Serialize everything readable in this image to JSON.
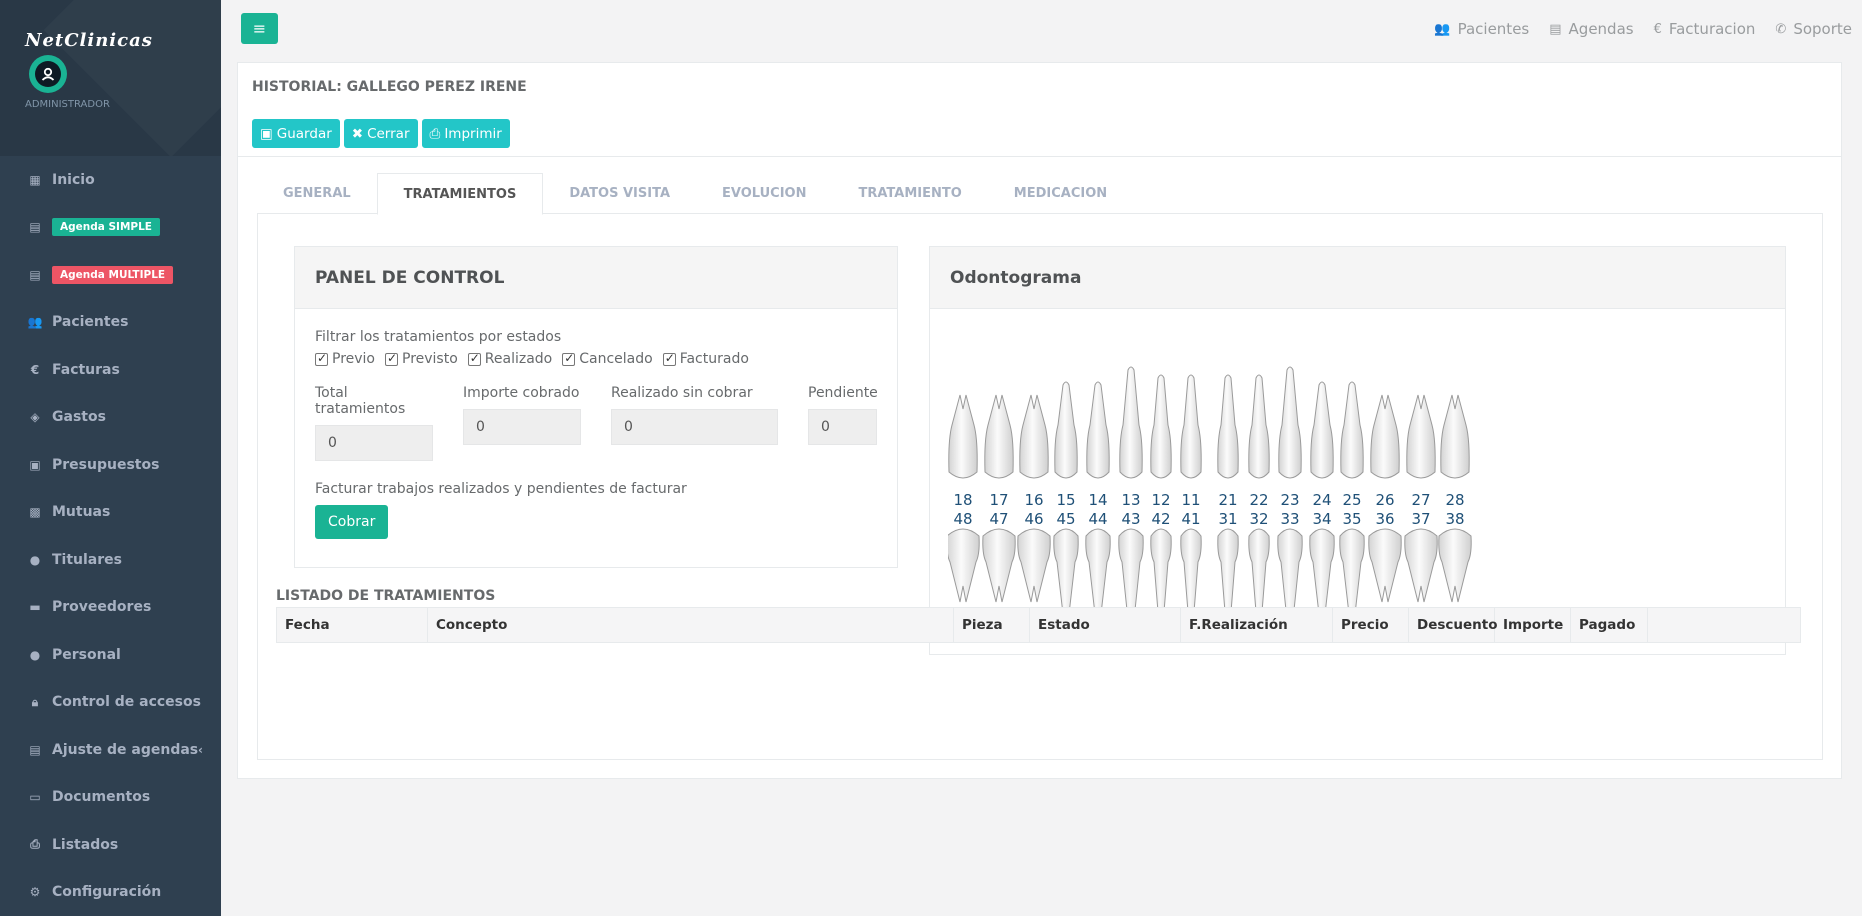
{
  "sidebar": {
    "brand": "NetClinicas",
    "role": "ADMINISTRADOR",
    "items": [
      {
        "label": "Inicio",
        "icon": "grid-icon"
      },
      {
        "badge": "Agenda SIMPLE",
        "icon": "calendar-icon",
        "badge_color": "#1ab394"
      },
      {
        "badge": "Agenda MULTIPLE",
        "icon": "calendar-icon",
        "badge_color": "#ed5565"
      },
      {
        "label": "Pacientes",
        "icon": "users-icon"
      },
      {
        "label": "Facturas",
        "icon": "euro-icon"
      },
      {
        "label": "Gastos",
        "icon": "tag-icon"
      },
      {
        "label": "Presupuestos",
        "icon": "money-icon"
      },
      {
        "label": "Mutuas",
        "icon": "briefcase-icon"
      },
      {
        "label": "Titulares",
        "icon": "user-icon"
      },
      {
        "label": "Proveedores",
        "icon": "truck-icon"
      },
      {
        "label": "Personal",
        "icon": "user-icon"
      },
      {
        "label": "Control de accesos",
        "icon": "lock-icon"
      },
      {
        "label": "Ajuste de agendas",
        "icon": "calendar-icon"
      },
      {
        "label": "Documentos",
        "icon": "folder-icon"
      },
      {
        "label": "Listados",
        "icon": "print-icon"
      },
      {
        "label": "Configuración",
        "icon": "gear-icon"
      }
    ]
  },
  "topbar": {
    "links": [
      {
        "label": "Pacientes",
        "icon": "users-icon"
      },
      {
        "label": "Agendas",
        "icon": "calendar-icon"
      },
      {
        "label": "Facturacion",
        "icon": "euro-icon"
      },
      {
        "label": "Soporte",
        "icon": "phone-icon"
      }
    ]
  },
  "page": {
    "title": "HISTORIAL: GALLEGO PEREZ IRENE",
    "buttons": {
      "save": "Guardar",
      "close": "Cerrar",
      "print": "Imprimir"
    }
  },
  "tabs": [
    "GENERAL",
    "TRATAMIENTOS",
    "DATOS VISITA",
    "EVOLUCION",
    "TRATAMIENTO",
    "MEDICACION"
  ],
  "active_tab": "TRATAMIENTOS",
  "control_panel": {
    "title": "PANEL DE CONTROL",
    "filter_label": "Filtrar los tratamientos por estados",
    "filters": [
      {
        "label": "Previo",
        "checked": true
      },
      {
        "label": "Previsto",
        "checked": true
      },
      {
        "label": "Realizado",
        "checked": true
      },
      {
        "label": "Cancelado",
        "checked": true
      },
      {
        "label": "Facturado",
        "checked": true
      }
    ],
    "fields": [
      {
        "label": "Total tratamientos",
        "value": "0"
      },
      {
        "label": "Importe cobrado",
        "value": "0"
      },
      {
        "label": "Realizado sin cobrar",
        "value": "0"
      },
      {
        "label": "Pendiente",
        "value": "0"
      }
    ],
    "bill_label": "Facturar trabajos realizados y pendientes de facturar",
    "charge_button": "Cobrar"
  },
  "odontogram": {
    "title": "Odontograma",
    "upper_teeth": [
      "18",
      "17",
      "16",
      "15",
      "14",
      "13",
      "12",
      "11",
      "21",
      "22",
      "23",
      "24",
      "25",
      "26",
      "27",
      "28"
    ],
    "lower_teeth": [
      "48",
      "47",
      "46",
      "45",
      "44",
      "43",
      "42",
      "41",
      "31",
      "32",
      "33",
      "34",
      "35",
      "36",
      "37",
      "38"
    ]
  },
  "treatments_list": {
    "title": "LISTADO DE TRATAMIENTOS",
    "columns": [
      "Fecha",
      "Concepto",
      "Pieza",
      "Estado",
      "F.Realización",
      "Precio",
      "Descuento",
      "Importe",
      "Pagado",
      ""
    ]
  }
}
